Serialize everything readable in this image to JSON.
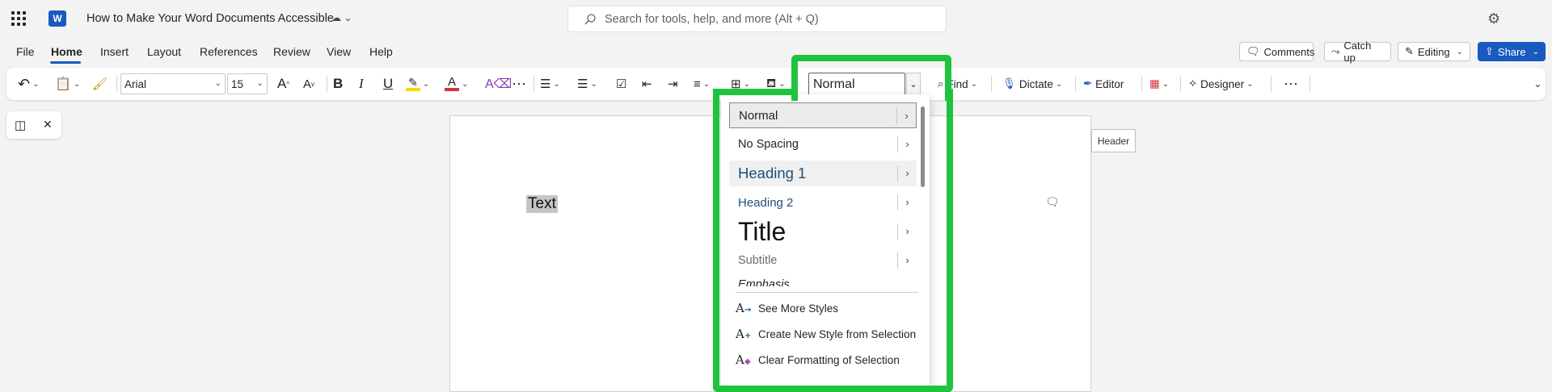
{
  "titlebar": {
    "app_name": "W",
    "doc_title": "How to Make Your Word Documents Accessible",
    "status_icon": "cloud-sync-icon",
    "search_placeholder": "Search for tools, help, and more (Alt + Q)"
  },
  "menu": {
    "items": [
      "File",
      "Home",
      "Insert",
      "Layout",
      "References",
      "Review",
      "View",
      "Help"
    ],
    "active": "Home"
  },
  "right_buttons": {
    "comments": "Comments",
    "catchup": "Catch up",
    "editing": "Editing",
    "share": "Share"
  },
  "ribbon": {
    "font_name": "Arial",
    "font_size": "15",
    "style_value": "Normal",
    "find": "Find",
    "dictate": "Dictate",
    "editor": "Editor",
    "designer": "Designer",
    "bold": "B",
    "italic": "I",
    "underline": "U",
    "grow_font": "A",
    "shrink_font": "A",
    "font_color": "A"
  },
  "colors": {
    "accent": "#185abd",
    "highlight_frame": "#1ec43f",
    "font_color_bar": "#d13438",
    "highlighter_bar": "#ffd700"
  },
  "document": {
    "selected_text": "Text",
    "header_tooltip": "Header"
  },
  "styles_menu": {
    "styles": [
      {
        "label": "Normal"
      },
      {
        "label": "No Spacing"
      },
      {
        "label": "Heading 1"
      },
      {
        "label": "Heading 2"
      },
      {
        "label": "Title"
      },
      {
        "label": "Subtitle"
      },
      {
        "label": "Emphasis"
      }
    ],
    "actions": [
      {
        "label": "See More Styles"
      },
      {
        "label": "Create New Style from Selection"
      },
      {
        "label": "Clear Formatting of Selection"
      }
    ]
  }
}
